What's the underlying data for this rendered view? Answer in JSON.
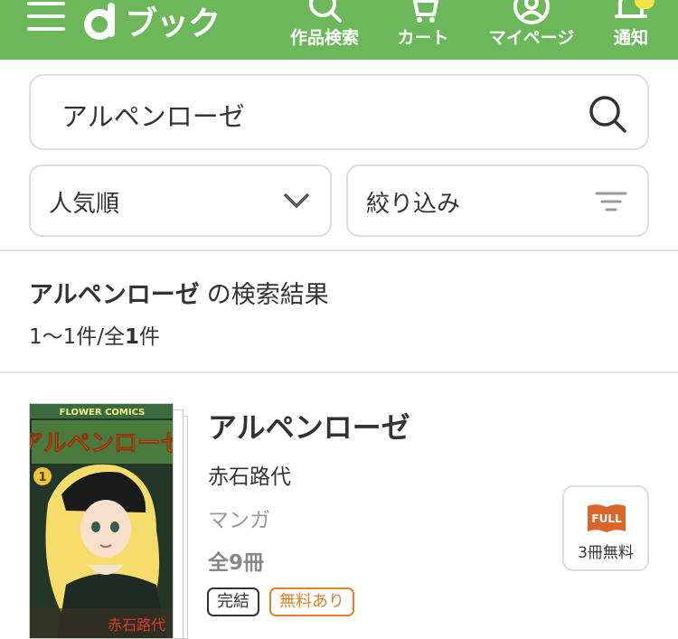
{
  "header": {
    "logo_text": "ブック",
    "nav": [
      {
        "label": "作品検索",
        "icon": "search-icon"
      },
      {
        "label": "カート",
        "icon": "cart-icon"
      },
      {
        "label": "マイページ",
        "icon": "user-icon"
      },
      {
        "label": "通知",
        "icon": "bell-icon"
      }
    ],
    "accent": "#6cb75a"
  },
  "search": {
    "value": "アルペンローゼ"
  },
  "sort": {
    "selected": "人気順"
  },
  "filter": {
    "label": "絞り込み"
  },
  "results": {
    "keyword": "アルペンローゼ",
    "title_suffix": "の検索結果",
    "range": "1〜1件/全",
    "total": "1",
    "unit": "件"
  },
  "book": {
    "cover_series": "FLOWER COMICS",
    "cover_title": "アルペンローゼ",
    "cover_volume": "1",
    "cover_author": "赤石路代",
    "title": "アルペンローゼ",
    "author": "赤石路代",
    "genre": "マンガ",
    "volumes": "全9冊",
    "tags": [
      "完結",
      "無料あり"
    ],
    "free_badge": {
      "icon_text": "FULL",
      "label": "3冊無料",
      "color": "#d9822b"
    }
  }
}
